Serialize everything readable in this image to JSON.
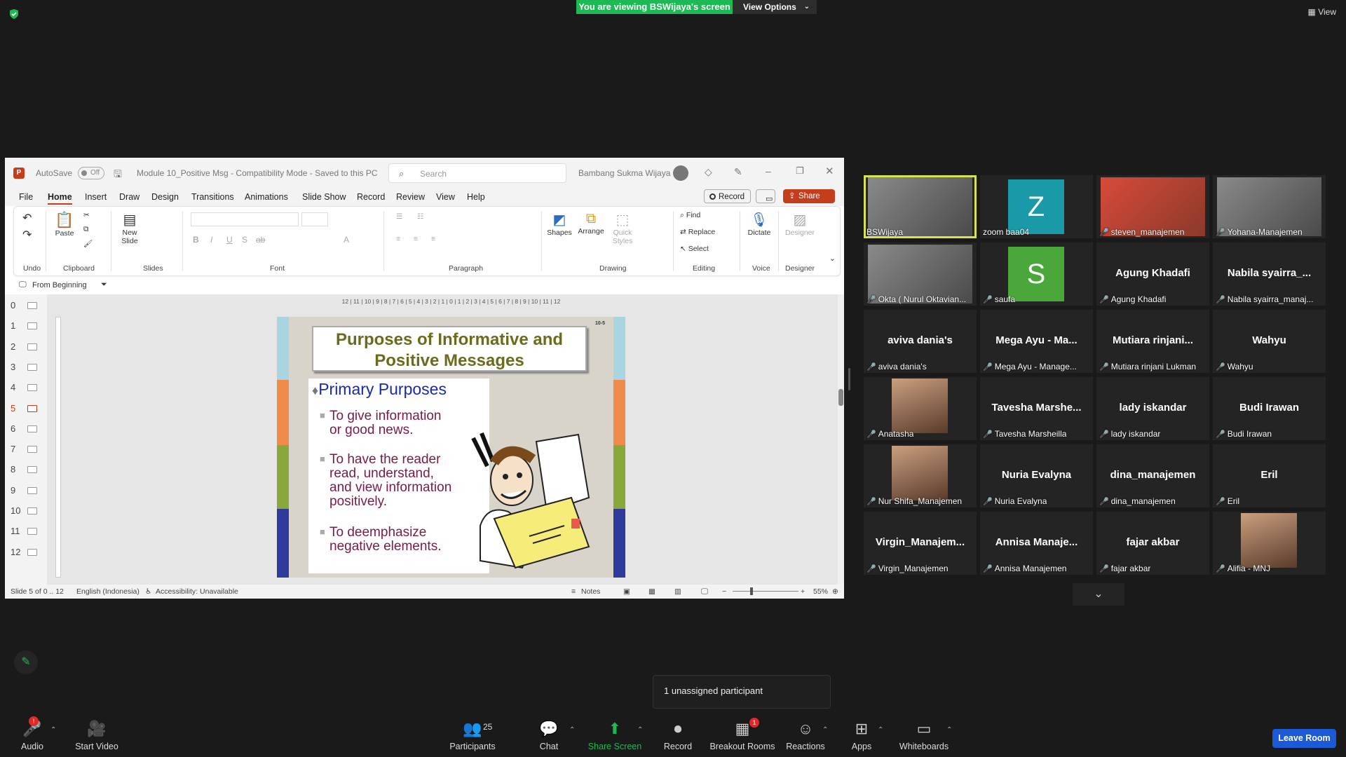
{
  "banner": {
    "viewing": "You are viewing BSWijaya's screen",
    "view_options": "View Options",
    "view": "View"
  },
  "ppt": {
    "autosave": "AutoSave",
    "autosave_state": "Off",
    "doc_title": "Module 10_Positive Msg  -  Compatibility Mode  -  Saved to this PC",
    "search_placeholder": "Search",
    "user": "Bambang Sukma Wijaya",
    "menu": [
      "File",
      "Home",
      "Insert",
      "Draw",
      "Design",
      "Transitions",
      "Animations",
      "Slide Show",
      "Record",
      "Review",
      "View",
      "Help"
    ],
    "record_btn": "Record",
    "share_btn": "Share",
    "ribbon": {
      "undo": "Undo",
      "clipboard": "Clipboard",
      "paste": "Paste",
      "slides": "Slides",
      "new_slide": "New Slide",
      "font": "Font",
      "paragraph": "Paragraph",
      "drawing": "Drawing",
      "shapes": "Shapes",
      "arrange": "Arrange",
      "quick_styles": "Quick Styles",
      "editing": "Editing",
      "find": "Find",
      "replace": "Replace",
      "select": "Select",
      "voice": "Voice",
      "dictate": "Dictate",
      "designer_group": "Designer",
      "designer": "Designer"
    },
    "qat_from_beginning": "From Beginning",
    "ruler": "12 | 11 | 10 | 9 | 8 | 7 | 6 | 5 | 4 | 3 | 2 | 1 | 0 | 1 | 2 | 3 | 4 | 5 | 6 | 7 | 8 | 9 | 10 | 11 | 12",
    "thumbnails": [
      "0",
      "1",
      "2",
      "3",
      "4",
      "5",
      "6",
      "7",
      "8",
      "9",
      "10",
      "11",
      "12"
    ],
    "current_slide_index": 5,
    "slide": {
      "page_no": "10-5",
      "title_line1": "Purposes of Informative and",
      "title_line2": "Positive Messages",
      "heading": "Primary Purposes",
      "bullets": [
        [
          "To give information",
          "or good news."
        ],
        [
          "To have the reader",
          "read, understand,",
          "and view information",
          "positively."
        ],
        [
          "To deemphasize",
          "negative elements."
        ]
      ]
    },
    "status": {
      "slide": "Slide 5 of 0 .. 12",
      "lang": "English (Indonesia)",
      "access": "Accessibility: Unavailable",
      "notes": "Notes",
      "zoom": "55%"
    }
  },
  "gallery": [
    {
      "name": "",
      "label": "BSWijaya",
      "muted": false,
      "video": true,
      "active": true
    },
    {
      "name": "Z",
      "label": "zoom baa04",
      "muted": false,
      "avatar": "#1a9aa8"
    },
    {
      "name": "",
      "label": "steven_manajemen",
      "muted": true,
      "video": true
    },
    {
      "name": "",
      "label": "Yohana-Manajemen",
      "muted": true,
      "video": true
    },
    {
      "name": "",
      "label": "Okta ( Nurul Oktavian...",
      "muted": true,
      "video": true
    },
    {
      "name": "S",
      "label": "saufa",
      "muted": true,
      "avatar": "#4aa83a"
    },
    {
      "name": "Agung Khadafi",
      "label": "Agung Khadafi",
      "muted": true
    },
    {
      "name": "Nabila  syairra_...",
      "label": "Nabila syairra_manaj...",
      "muted": true
    },
    {
      "name": "aviva dania's",
      "label": "aviva dania's",
      "muted": true
    },
    {
      "name": "Mega Ayu - Ma...",
      "label": "Mega Ayu - Manage...",
      "muted": true
    },
    {
      "name": "Mutiara  rinjani...",
      "label": "Mutiara rinjani Lukman",
      "muted": true
    },
    {
      "name": "Wahyu",
      "label": "Wahyu",
      "muted": true
    },
    {
      "name": "",
      "label": "Anatasha",
      "muted": true,
      "photo": true
    },
    {
      "name": "Tavesha  Marshe...",
      "label": "Tavesha Marsheilla",
      "muted": true
    },
    {
      "name": "lady iskandar",
      "label": "lady iskandar",
      "muted": true
    },
    {
      "name": "Budi Irawan",
      "label": "Budi Irawan",
      "muted": true
    },
    {
      "name": "",
      "label": "Nur Shifa_Manajemen",
      "muted": true,
      "photo": true
    },
    {
      "name": "Nuria Evalyna",
      "label": "Nuria Evalyna",
      "muted": true
    },
    {
      "name": "dina_manajemen",
      "label": "dina_manajemen",
      "muted": true
    },
    {
      "name": "Eril",
      "label": "Eril",
      "muted": true
    },
    {
      "name": "Virgin_Manajem...",
      "label": "Virgin_Manajemen",
      "muted": true
    },
    {
      "name": "Annisa  Manaje...",
      "label": "Annisa Manajemen",
      "muted": true
    },
    {
      "name": "fajar akbar",
      "label": "fajar akbar",
      "muted": true
    },
    {
      "name": "",
      "label": "Alifia - MNJ",
      "muted": true,
      "photo": true
    }
  ],
  "toolbar": {
    "audio": "Audio",
    "audio_badge": "!",
    "start_video": "Start Video",
    "participants": "Participants",
    "participants_count": "25",
    "chat": "Chat",
    "share_screen": "Share Screen",
    "record": "Record",
    "breakout": "Breakout Rooms",
    "breakout_badge": "1",
    "reactions": "Reactions",
    "apps": "Apps",
    "whiteboards": "Whiteboards",
    "leave": "Leave Room"
  },
  "tooltip": "1 unassigned participant",
  "colors": {
    "green": "#1db954",
    "pp_red": "#c43e1c",
    "leave": "#1a5ad6",
    "active_outline": "#d8e24a"
  }
}
